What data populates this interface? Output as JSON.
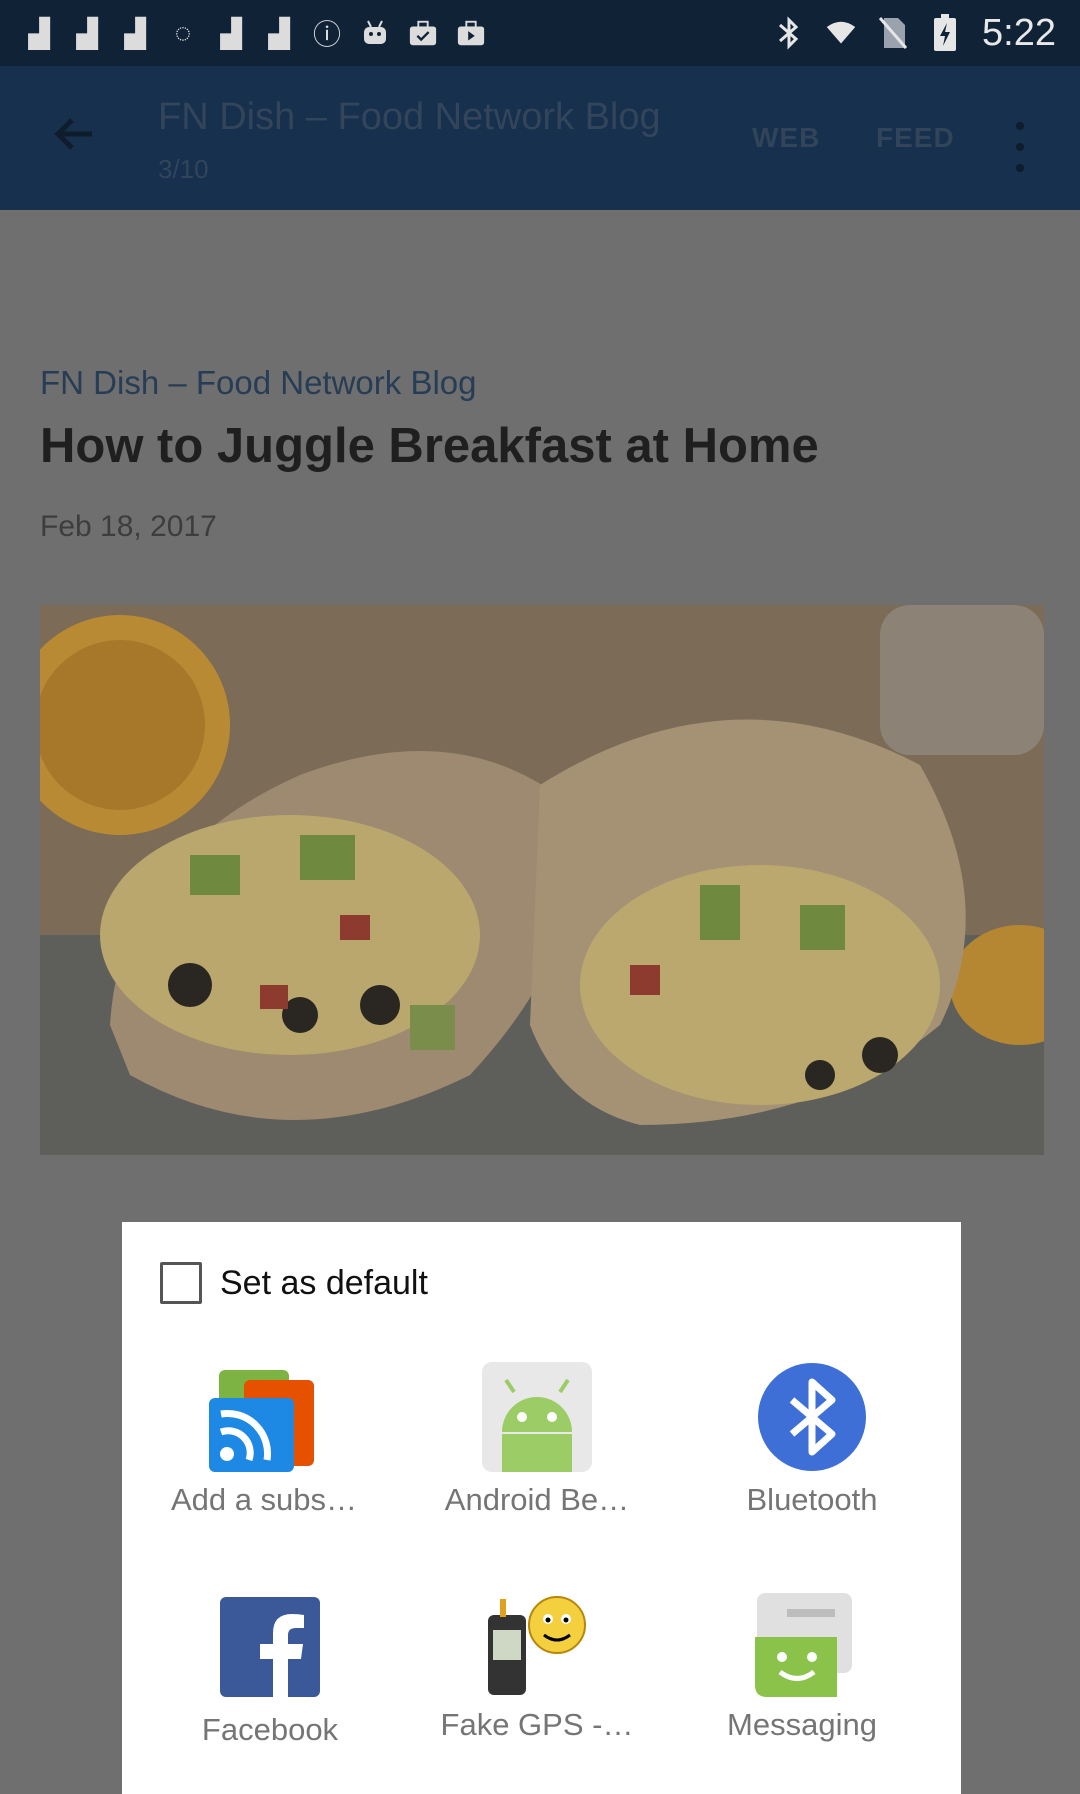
{
  "status_bar": {
    "time": "5:22",
    "left_icons": [
      "notification-icon",
      "notification-icon",
      "notification-icon",
      "sync-icon",
      "notification-icon",
      "notification-icon",
      "info-icon",
      "android-icon",
      "briefcase-icon",
      "briefcase-icon"
    ],
    "right_icons": [
      "bluetooth-icon",
      "wifi-icon",
      "no-sim-icon",
      "battery-charging-icon"
    ]
  },
  "app_bar": {
    "title": "FN Dish – Food Network Blog",
    "counter": "3/10",
    "web_label": "WEB",
    "feed_label": "FEED"
  },
  "article": {
    "blog_name": "FN Dish – Food Network Blog",
    "headline": "How to Juggle Breakfast at Home",
    "date": "Feb 18, 2017"
  },
  "share_dialog": {
    "default_label": "Set as default",
    "default_checked": false,
    "apps": [
      {
        "label": "Add a subs…",
        "icon": "rss-subscription-icon"
      },
      {
        "label": "Android Be…",
        "icon": "android-beam-icon"
      },
      {
        "label": "Bluetooth",
        "icon": "bluetooth-icon"
      },
      {
        "label": "Facebook",
        "icon": "facebook-icon"
      },
      {
        "label": "Fake GPS -…",
        "icon": "gps-device-icon"
      },
      {
        "label": "Messaging",
        "icon": "messaging-icon"
      }
    ]
  },
  "colors": {
    "app_bar": "#16304d",
    "status_bar": "#0f2236",
    "scrim": "#6f6f6f",
    "bluetooth": "#3d6fd6",
    "facebook": "#3b5998",
    "android": "#9ccc65"
  }
}
